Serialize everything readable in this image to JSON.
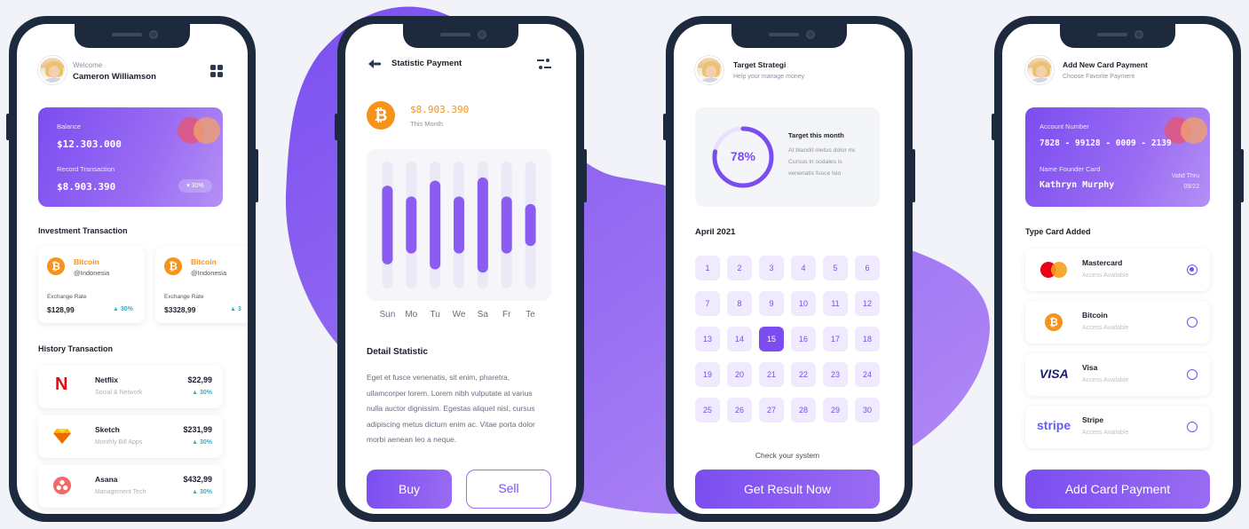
{
  "colors": {
    "accent": "#7b4df0",
    "accent_light": "#9a6cf3",
    "bitcoin": "#f7931a",
    "up": "#21b8c9",
    "background": "#f1f3f8"
  },
  "screen1": {
    "welcome": "Welcome",
    "user_name": "Cameron Williamson",
    "card": {
      "balance_label": "Balance",
      "balance_value": "$12.303.000",
      "record_label": "Record Transaction",
      "record_value": "$8.903.390",
      "badge": "▾ 30%"
    },
    "investment_title": "Investment Transaction",
    "investments": [
      {
        "name": "Bitcoin",
        "region": "@Indonesia",
        "rate_label": "Exchange Rate",
        "rate_value": "$128,99",
        "change": "▲ 30%"
      },
      {
        "name": "Bitcoin",
        "region": "@Indonesia",
        "rate_label": "Exchange Rate",
        "rate_value": "$3328,99",
        "change": "▲ 3"
      }
    ],
    "history_title": "History Transaction",
    "history": [
      {
        "name": "Netflix",
        "sub": "Social & Network",
        "amount": "$22,99",
        "change": "▲ 30%",
        "icon": "netflix-icon"
      },
      {
        "name": "Sketch",
        "sub": "Monthly Bill Apps",
        "amount": "$231,99",
        "change": "▲ 30%",
        "icon": "sketch-icon"
      },
      {
        "name": "Asana",
        "sub": "Management Tech",
        "amount": "$432,99",
        "change": "▲ 30%",
        "icon": "asana-icon"
      }
    ]
  },
  "screen2": {
    "title": "Statistic Payment",
    "amount": "$8.903.390",
    "period": "This Month",
    "chart_data": {
      "type": "bar",
      "categories": [
        "Sun",
        "Mo",
        "Tu",
        "We",
        "Sa",
        "Fr",
        "Te"
      ],
      "values": [
        0.62,
        0.45,
        0.7,
        0.45,
        0.75,
        0.45,
        0.33
      ],
      "ylim": [
        0,
        1
      ]
    },
    "detail_title": "Detail Statistic",
    "detail_text": "Eget et fusce venenatis, sit enim, pharetra, ullamcorper lorem. Lorem nibh vulputate at varius nulla auctor dignissim. Egestas aliquet nisl, cursus adipiscing metus dictum enim ac. Vitae porta dolor morbi aenean leo a neque.",
    "buy_label": "Buy",
    "sell_label": "Sell"
  },
  "screen3": {
    "title": "Target Strategi",
    "subtitle": "Help your manage money",
    "progress_percent": 78,
    "progress_label": "78%",
    "target_title": "Target this month",
    "target_text": "At blandit metus dolor mi. Cursus in sodales is venenatis fusce lsio",
    "month": "April 2021",
    "days": [
      "1",
      "2",
      "3",
      "4",
      "5",
      "6",
      "7",
      "8",
      "9",
      "10",
      "11",
      "12",
      "13",
      "14",
      "15",
      "16",
      "17",
      "18",
      "19",
      "20",
      "21",
      "22",
      "23",
      "24",
      "25",
      "26",
      "27",
      "28",
      "29",
      "30"
    ],
    "selected_day": "15",
    "check_text": "Check your system",
    "button_label": "Get Result Now"
  },
  "screen4": {
    "title": "Add New Card Payment",
    "subtitle": "Choose Favorite Payment",
    "card": {
      "account_label": "Account Number",
      "account_number": "7828 - 99128 - 0009 - 2139",
      "founder_label": "Name Founder Card",
      "founder_name": "Kathryn Murphy",
      "valid_label": "Valid Thru",
      "valid_value": "09/22"
    },
    "type_title": "Type Card Added",
    "methods": [
      {
        "name": "Mastercard",
        "status": "Access Available",
        "selected": true,
        "icon": "mastercard-icon"
      },
      {
        "name": "Bitcoin",
        "status": "Access Available",
        "selected": false,
        "icon": "bitcoin-icon"
      },
      {
        "name": "Visa",
        "status": "Access Available",
        "selected": false,
        "icon": "visa-icon",
        "logo_text": "VISA"
      },
      {
        "name": "Stripe",
        "status": "Access Available",
        "selected": false,
        "icon": "stripe-icon",
        "logo_text": "stripe"
      }
    ],
    "button_label": "Add Card Payment"
  }
}
